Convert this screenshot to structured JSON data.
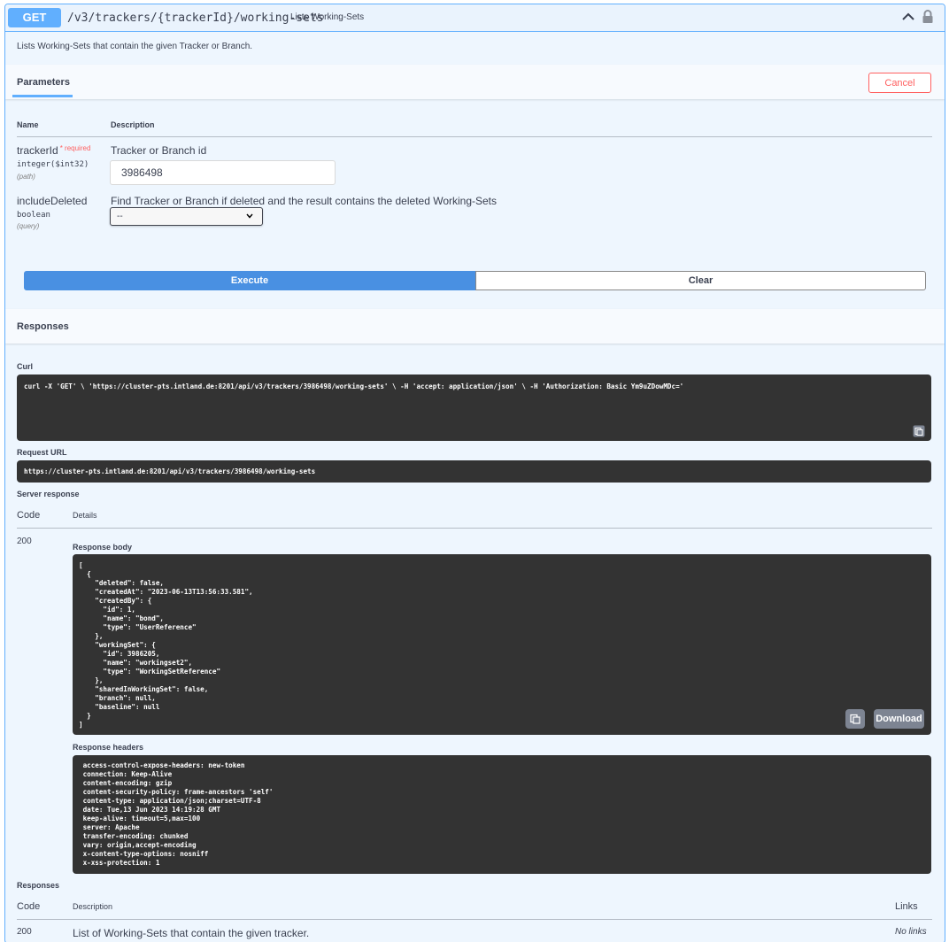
{
  "operation": {
    "method": "GET",
    "path": "/v3/trackers/{trackerId}/working-sets",
    "summary": "Lists Working-Sets",
    "description": "Lists Working-Sets that contain the given Tracker or Branch."
  },
  "parameters_section": {
    "tab_label": "Parameters",
    "cancel_label": "Cancel",
    "col_name": "Name",
    "col_description": "Description",
    "params": [
      {
        "name": "trackerId",
        "required_mark": "*",
        "required_text": "required",
        "type": "integer($int32)",
        "in": "(path)",
        "description": "Tracker or Branch id",
        "value": "3986498"
      },
      {
        "name": "includeDeleted",
        "type": "boolean",
        "in": "(query)",
        "description": "Find Tracker or Branch if deleted and the result contains the deleted Working-Sets",
        "selected": "--"
      }
    ]
  },
  "actions": {
    "execute_label": "Execute",
    "clear_label": "Clear"
  },
  "responses_section": {
    "title": "Responses",
    "curl_label": "Curl",
    "curl": "curl -X 'GET' \\ 'https://cluster-pts.intland.de:8201/api/v3/trackers/3986498/working-sets' \\ -H 'accept: application/json' \\ -H 'Authorization: Basic Ym9uZDowMDc='",
    "request_url_label": "Request URL",
    "request_url": "https://cluster-pts.intland.de:8201/api/v3/trackers/3986498/working-sets",
    "server_response_label": "Server response",
    "col_code": "Code",
    "col_details": "Details",
    "code": "200",
    "response_body_label": "Response body",
    "response_body_lines": [
      "[",
      "  {",
      "    \"deleted\": false,",
      "    \"createdAt\": \"2023-06-13T13:56:33.581\",",
      "    \"createdBy\": {",
      "      \"id\": 1,",
      "      \"name\": \"bond\",",
      "      \"type\": \"UserReference\"",
      "    },",
      "    \"workingSet\": {",
      "      \"id\": 3986205,",
      "      \"name\": \"workingset2\",",
      "      \"type\": \"WorkingSetReference\"",
      "    },",
      "    \"sharedInWorkingSet\": false,",
      "    \"branch\": null,",
      "    \"baseline\": null",
      "  }",
      "]"
    ],
    "download_label": "Download",
    "response_headers_label": "Response headers",
    "response_headers_lines": [
      " access-control-expose-headers: new-token ",
      " connection: Keep-Alive ",
      " content-encoding: gzip ",
      " content-security-policy: frame-ancestors 'self' ",
      " content-type: application/json;charset=UTF-8 ",
      " date: Tue,13 Jun 2023 14:19:28 GMT ",
      " keep-alive: timeout=5,max=100 ",
      " server: Apache ",
      " transfer-encoding: chunked ",
      " vary: origin,accept-encoding ",
      " x-content-type-options: nosniff ",
      " x-xss-protection: 1 "
    ]
  },
  "documented_responses": {
    "title": "Responses",
    "col_code": "Code",
    "col_description": "Description",
    "col_links": "Links",
    "rows": [
      {
        "code": "200",
        "description": "List of Working-Sets that contain the given tracker.",
        "links": "No links"
      }
    ]
  }
}
